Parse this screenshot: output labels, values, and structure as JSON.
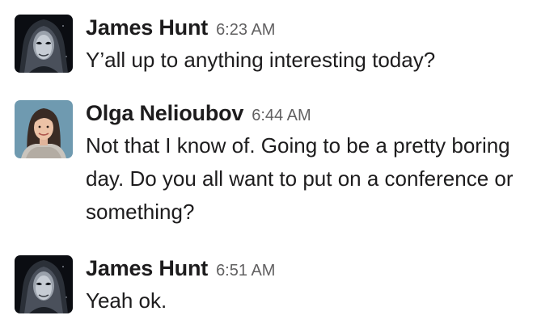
{
  "messages": [
    {
      "author": "James Hunt",
      "time": "6:23 AM",
      "text": "Y’all up to anything interesting today?",
      "avatar_icon": "dark-hooded-figure-avatar"
    },
    {
      "author": "Olga Nelioubov",
      "time": "6:44 AM",
      "text": "Not that I know of. Going to be a pretty boring day. Do you all want to put on a conference or something?",
      "avatar_icon": "woman-portrait-avatar"
    },
    {
      "author": "James Hunt",
      "time": "6:51 AM",
      "text": "Yeah ok.",
      "avatar_icon": "dark-hooded-figure-avatar"
    }
  ]
}
